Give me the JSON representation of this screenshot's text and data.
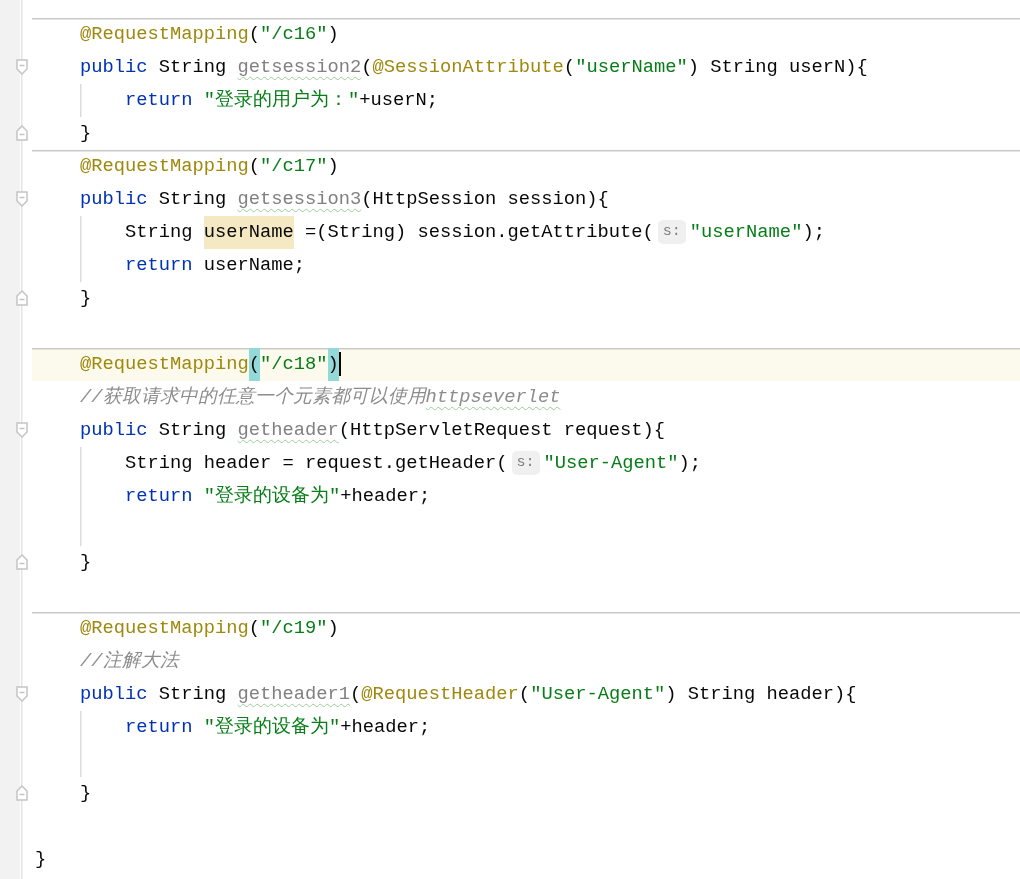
{
  "class_body": [
    {
      "separator": true,
      "current": false,
      "tokens": [
        {
          "text": "@RequestMapping",
          "kind": "annotation"
        },
        {
          "text": "(",
          "kind": "plain"
        },
        {
          "text": "\"/c16\"",
          "kind": "string"
        },
        {
          "text": ")",
          "kind": "plain"
        }
      ]
    },
    {
      "kind": "fold_start",
      "separator": false,
      "current": false,
      "tokens": [
        {
          "text": "public",
          "kind": "keyword"
        },
        {
          "text": " String ",
          "kind": "plain"
        },
        {
          "text": "getsession2",
          "kind": "unused_method"
        },
        {
          "text": "(",
          "kind": "plain"
        },
        {
          "text": "@SessionAttribute",
          "kind": "annotation"
        },
        {
          "text": "(",
          "kind": "plain"
        },
        {
          "text": "\"userName\"",
          "kind": "string"
        },
        {
          "text": ") String userN){",
          "kind": "plain"
        }
      ],
      "children": [
        {
          "separator": false,
          "current": false,
          "tokens": [
            {
              "text": "return",
              "kind": "keyword"
            },
            {
              "text": " \"登录的用户为：\"",
              "kind": "string"
            },
            {
              "text": "+userN;",
              "kind": "plain"
            }
          ]
        }
      ]
    },
    {
      "kind": "fold_end",
      "separator": false,
      "current": false,
      "tokens": [
        {
          "text": "}",
          "kind": "plain"
        }
      ]
    },
    {
      "separator": true,
      "current": false,
      "tokens": [
        {
          "text": "@RequestMapping",
          "kind": "annotation"
        },
        {
          "text": "(",
          "kind": "plain"
        },
        {
          "text": "\"/c17\"",
          "kind": "string"
        },
        {
          "text": ")",
          "kind": "plain"
        }
      ]
    },
    {
      "kind": "fold_start",
      "separator": false,
      "current": false,
      "tokens": [
        {
          "text": "public",
          "kind": "keyword"
        },
        {
          "text": " String ",
          "kind": "plain"
        },
        {
          "text": "getsession3",
          "kind": "unused_method"
        },
        {
          "text": "(HttpSession session){",
          "kind": "plain"
        }
      ],
      "children": [
        {
          "separator": false,
          "current": false,
          "tokens": [
            {
              "text": "String ",
              "kind": "plain"
            },
            {
              "text": "userName",
              "kind": "usage"
            },
            {
              "text": " =(String) session.getAttribute(",
              "kind": "plain"
            },
            {
              "text": "s:",
              "kind": "hint"
            },
            {
              "text": "\"userName\"",
              "kind": "string"
            },
            {
              "text": ");",
              "kind": "plain"
            }
          ]
        },
        {
          "separator": false,
          "current": false,
          "tokens": [
            {
              "text": "return",
              "kind": "keyword"
            },
            {
              "text": " userName;",
              "kind": "plain"
            }
          ]
        }
      ]
    },
    {
      "kind": "fold_end",
      "separator": false,
      "current": false,
      "tokens": [
        {
          "text": "}",
          "kind": "plain"
        }
      ]
    },
    {
      "separator": false,
      "current": false
    },
    {
      "separator": true,
      "current": true,
      "tokens": [
        {
          "text": "@RequestMapping",
          "kind": "annotation"
        },
        {
          "text": "(",
          "kind": "brace_match"
        },
        {
          "text": "\"/c18\"",
          "kind": "string"
        },
        {
          "text": ")",
          "kind": "brace_match",
          "caret": true
        }
      ]
    },
    {
      "separator": false,
      "current": false,
      "tokens": [
        {
          "text": "//获取请求中的任意一个元素都可以使用",
          "kind": "comment"
        },
        {
          "text": "httpseverlet",
          "kind": "comment_typo"
        }
      ]
    },
    {
      "kind": "fold_start",
      "separator": false,
      "current": false,
      "tokens": [
        {
          "text": "public",
          "kind": "keyword"
        },
        {
          "text": " String ",
          "kind": "plain"
        },
        {
          "text": "getheader",
          "kind": "unused_method"
        },
        {
          "text": "(HttpServletRequest request){",
          "kind": "plain"
        }
      ],
      "children": [
        {
          "separator": false,
          "current": false,
          "tokens": [
            {
              "text": "String header = request.getHeader(",
              "kind": "plain"
            },
            {
              "text": "s:",
              "kind": "hint"
            },
            {
              "text": "\"User-Agent\"",
              "kind": "string"
            },
            {
              "text": ");",
              "kind": "plain"
            }
          ]
        },
        {
          "separator": false,
          "current": false,
          "tokens": [
            {
              "text": "return",
              "kind": "keyword"
            },
            {
              "text": " \"登录的设备为\"",
              "kind": "string"
            },
            {
              "text": "+header;",
              "kind": "plain"
            }
          ]
        },
        {
          "separator": false,
          "current": false
        }
      ]
    },
    {
      "kind": "fold_end",
      "separator": false,
      "current": false,
      "tokens": [
        {
          "text": "}",
          "kind": "plain"
        }
      ]
    },
    {
      "separator": false,
      "current": false
    },
    {
      "separator": true,
      "current": false,
      "tokens": [
        {
          "text": "@RequestMapping",
          "kind": "annotation"
        },
        {
          "text": "(",
          "kind": "plain"
        },
        {
          "text": "\"/c19\"",
          "kind": "string"
        },
        {
          "text": ")",
          "kind": "plain"
        }
      ]
    },
    {
      "separator": false,
      "current": false,
      "tokens": [
        {
          "text": "//注解大法",
          "kind": "comment"
        }
      ]
    },
    {
      "kind": "fold_start",
      "separator": false,
      "current": false,
      "tokens": [
        {
          "text": "public",
          "kind": "keyword"
        },
        {
          "text": " String ",
          "kind": "plain"
        },
        {
          "text": "getheader1",
          "kind": "unused_method"
        },
        {
          "text": "(",
          "kind": "plain"
        },
        {
          "text": "@RequestHeader",
          "kind": "annotation"
        },
        {
          "text": "(",
          "kind": "plain"
        },
        {
          "text": "\"User-Agent\"",
          "kind": "string"
        },
        {
          "text": ") String header){",
          "kind": "plain"
        }
      ],
      "children": [
        {
          "separator": false,
          "current": false,
          "tokens": [
            {
              "text": "return",
              "kind": "keyword"
            },
            {
              "text": " \"登录的设备为\"",
              "kind": "string"
            },
            {
              "text": "+header;",
              "kind": "plain"
            }
          ]
        },
        {
          "separator": false,
          "current": false
        }
      ]
    },
    {
      "kind": "fold_end",
      "separator": false,
      "current": false,
      "tokens": [
        {
          "text": "}",
          "kind": "plain"
        }
      ]
    },
    {
      "separator": false,
      "current": false
    }
  ],
  "closing_line": {
    "separator": false,
    "current": false,
    "tokens": [
      {
        "text": "}",
        "kind": "plain"
      }
    ]
  }
}
